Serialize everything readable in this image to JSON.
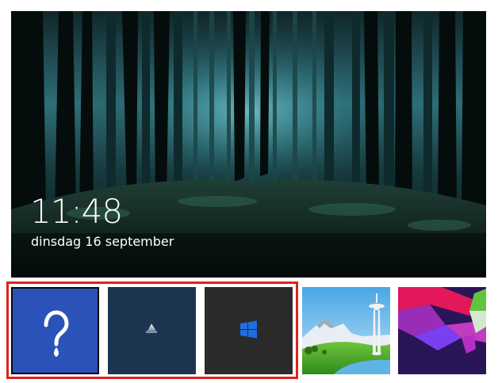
{
  "lock_screen": {
    "time": "11:48",
    "date": "dinsdag 16 september"
  },
  "thumbnails": [
    {
      "name": "help",
      "icon": "question-mark-icon",
      "selected": true
    },
    {
      "name": "mountain",
      "icon": "mountain-icon",
      "selected": false
    },
    {
      "name": "windows",
      "icon": "windows-logo-icon",
      "selected": false
    },
    {
      "name": "seattle",
      "icon": "space-needle-icon",
      "selected": false
    },
    {
      "name": "geometric",
      "icon": "geometric-shapes-icon",
      "selected": false
    }
  ],
  "colors": {
    "selection_border": "#e02020",
    "help_tile": "#2a52b8",
    "mountain_tile": "#1b3550",
    "windows_tile": "#2b2b2b"
  }
}
